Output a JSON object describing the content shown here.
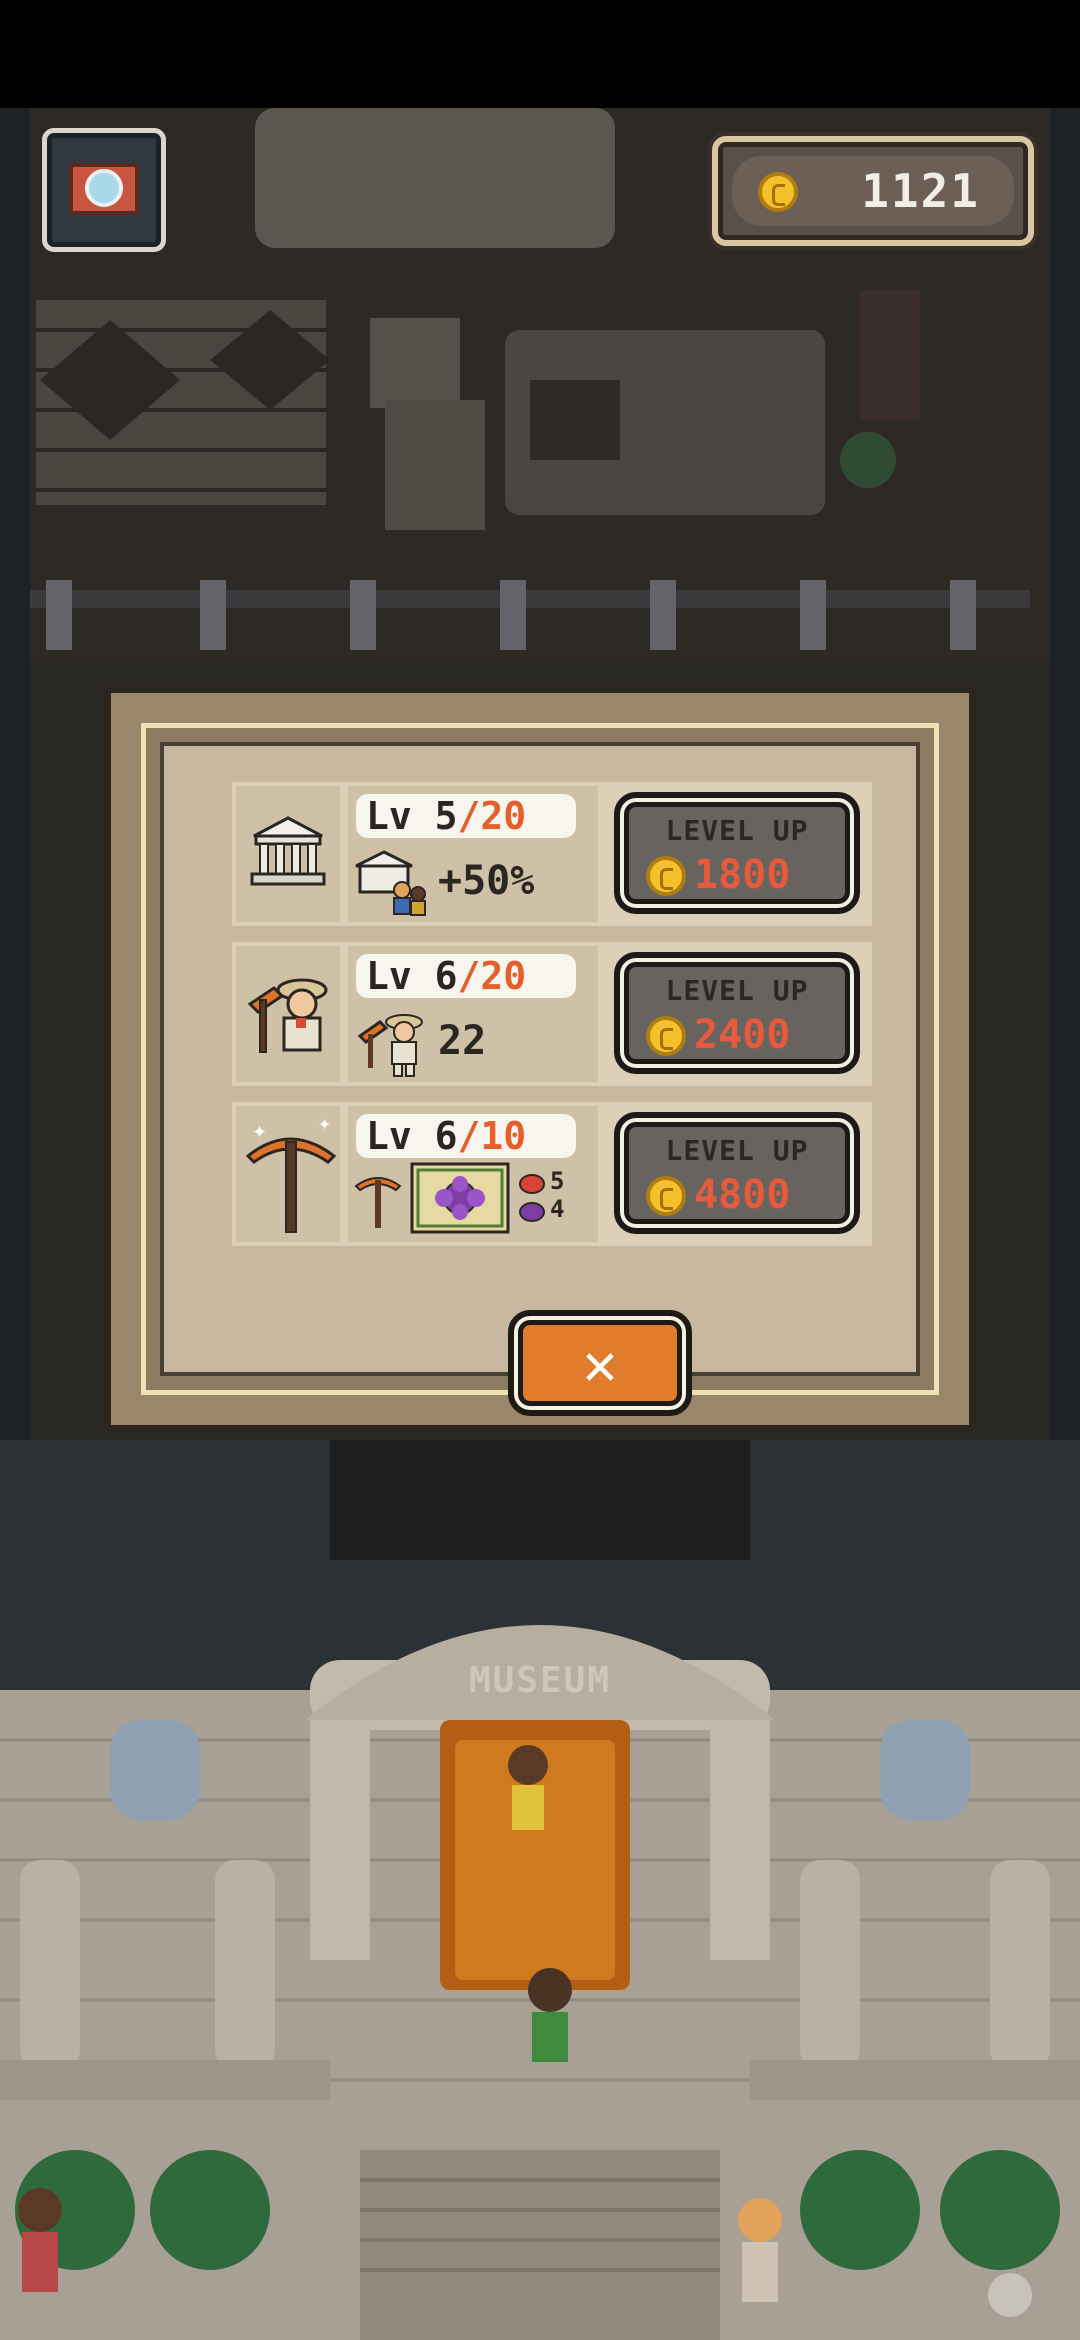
{
  "hud": {
    "coins": "1121",
    "camera_icon": "camera-icon",
    "coin_icon": "coin-icon"
  },
  "upgrade_dialog": {
    "rows": [
      {
        "name": "museum",
        "level_label": "Lv 5",
        "level_max": "/20",
        "stat": "+50%",
        "button_label": "LEVEL UP",
        "cost": "1800"
      },
      {
        "name": "explorer",
        "level_label": "Lv 6",
        "level_max": "/20",
        "stat": "22",
        "button_label": "LEVEL UP",
        "cost": "2400"
      },
      {
        "name": "pickaxe",
        "level_label": "Lv 6",
        "level_max": "/10",
        "stat_a": "5",
        "stat_b": "4",
        "button_label": "LEVEL UP",
        "cost": "4800"
      }
    ],
    "close_glyph": "✕"
  },
  "scene": {
    "sign_text": "MUSEUM"
  },
  "colors": {
    "accent_orange": "#e07c2c",
    "cost_red": "#e85a3c",
    "level_max_orange": "#e55f2b",
    "coin_gold": "#f4c12c"
  }
}
